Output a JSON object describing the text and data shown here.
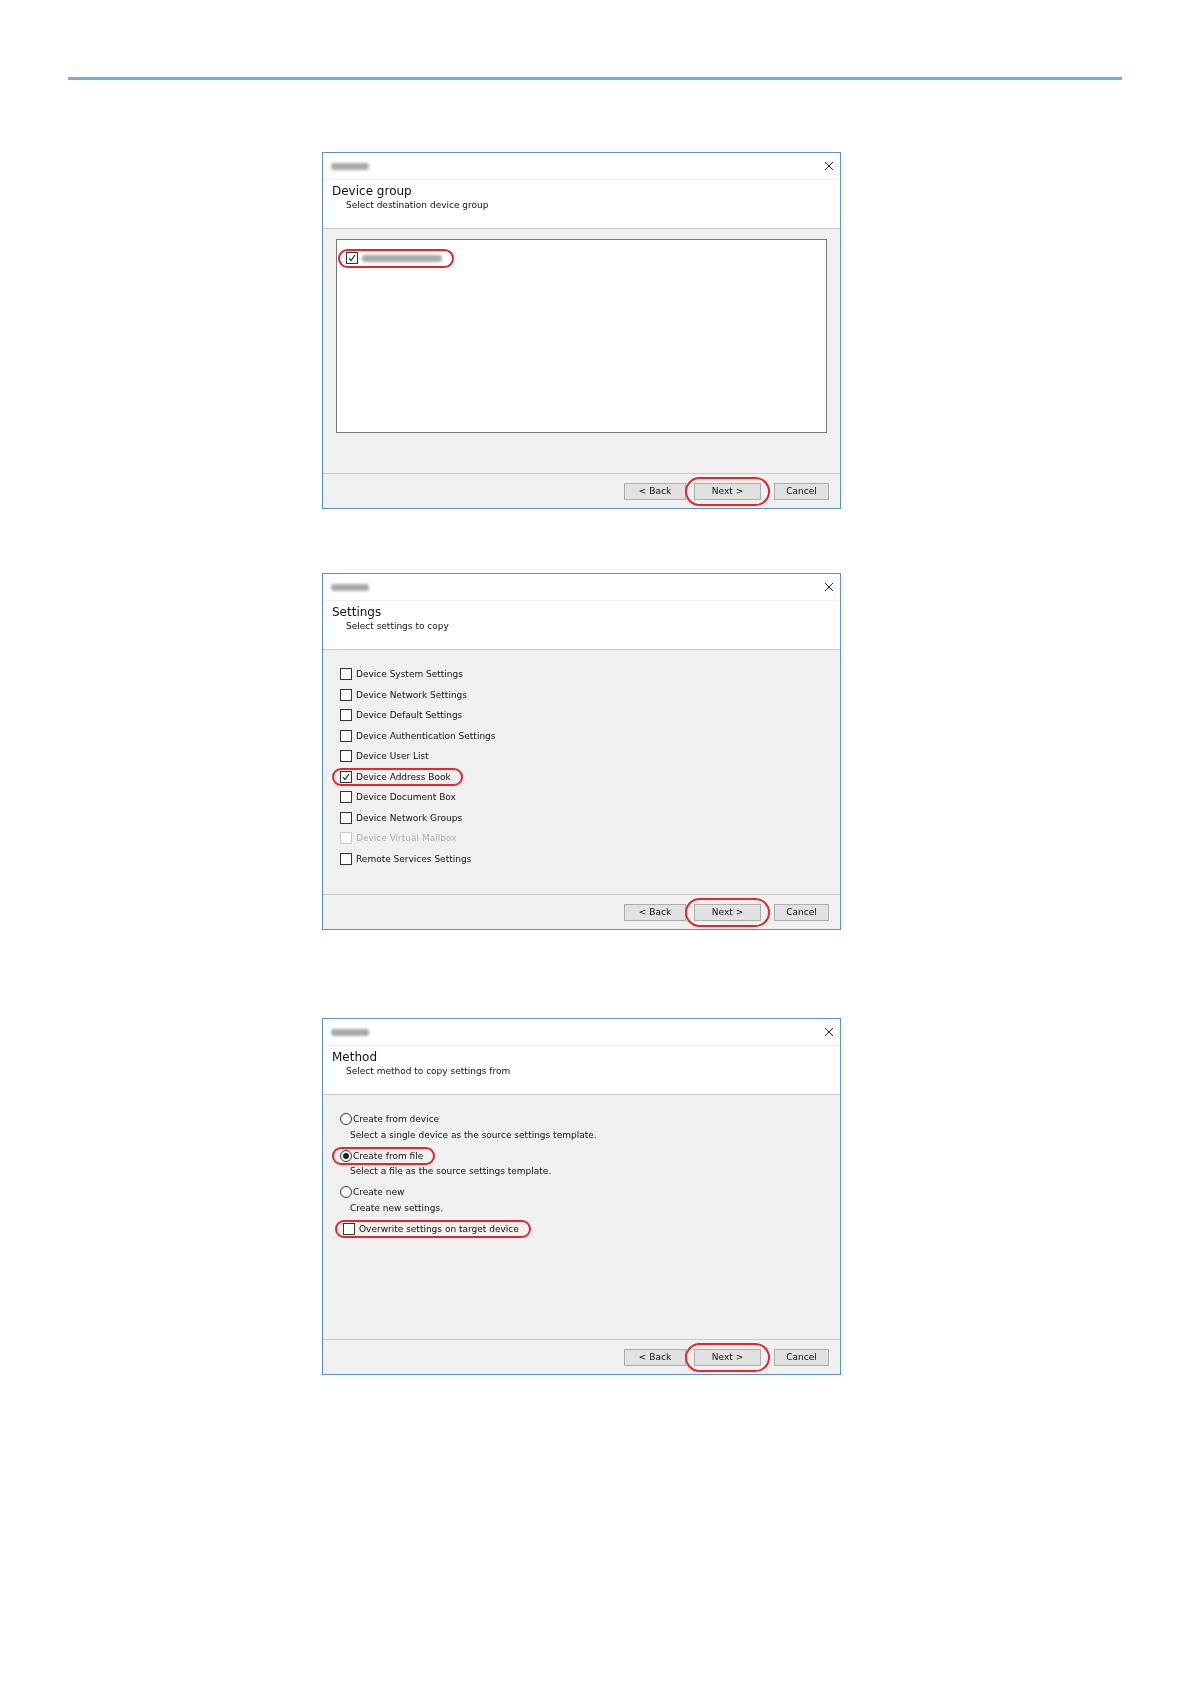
{
  "dialogs": [
    {
      "heading": "Device group",
      "subtitle": "Select destination device group",
      "body": {
        "kind": "list_box",
        "items": [
          {
            "checked": true,
            "highlighted": true
          }
        ]
      },
      "buttons": [
        {
          "label": "< Back",
          "highlighted": false
        },
        {
          "label": "Next >",
          "highlighted": true
        },
        {
          "label": "Cancel",
          "highlighted": false
        }
      ]
    },
    {
      "heading": "Settings",
      "subtitle": "Select settings to copy",
      "body": {
        "kind": "checklist",
        "items": [
          {
            "label": "Device System Settings",
            "checked": false,
            "disabled": false,
            "highlighted": false
          },
          {
            "label": "Device Network Settings",
            "checked": false,
            "disabled": false,
            "highlighted": false
          },
          {
            "label": "Device Default Settings",
            "checked": false,
            "disabled": false,
            "highlighted": false
          },
          {
            "label": "Device Authentication Settings",
            "checked": false,
            "disabled": false,
            "highlighted": false
          },
          {
            "label": "Device User List",
            "checked": false,
            "disabled": false,
            "highlighted": false
          },
          {
            "label": "Device Address Book",
            "checked": true,
            "disabled": false,
            "highlighted": true
          },
          {
            "label": "Device Document Box",
            "checked": false,
            "disabled": false,
            "highlighted": false
          },
          {
            "label": "Device Network Groups",
            "checked": false,
            "disabled": false,
            "highlighted": false
          },
          {
            "label": "Device Virtual Mailbox",
            "checked": false,
            "disabled": true,
            "highlighted": false
          },
          {
            "label": "Remote Services Settings",
            "checked": false,
            "disabled": false,
            "highlighted": false
          }
        ]
      },
      "buttons": [
        {
          "label": "< Back",
          "highlighted": false
        },
        {
          "label": "Next >",
          "highlighted": true
        },
        {
          "label": "Cancel",
          "highlighted": false
        }
      ]
    },
    {
      "heading": "Method",
      "subtitle": "Select method to copy settings from",
      "body": {
        "kind": "options",
        "items": [
          {
            "kind": "radio",
            "label": "Create from device",
            "description": "Select a single device as the source settings template.",
            "selected": false,
            "highlighted": false
          },
          {
            "kind": "radio",
            "label": "Create from file",
            "description": "Select a file as the source settings template.",
            "selected": true,
            "highlighted": true
          },
          {
            "kind": "radio",
            "label": "Create new",
            "description": "Create new settings.",
            "selected": false,
            "highlighted": false
          },
          {
            "kind": "checkbox",
            "label": "Overwrite settings on target device",
            "checked": false,
            "highlighted": true
          }
        ]
      },
      "buttons": [
        {
          "label": "< Back",
          "highlighted": false
        },
        {
          "label": "Next >",
          "highlighted": true
        },
        {
          "label": "Cancel",
          "highlighted": false
        }
      ]
    }
  ]
}
